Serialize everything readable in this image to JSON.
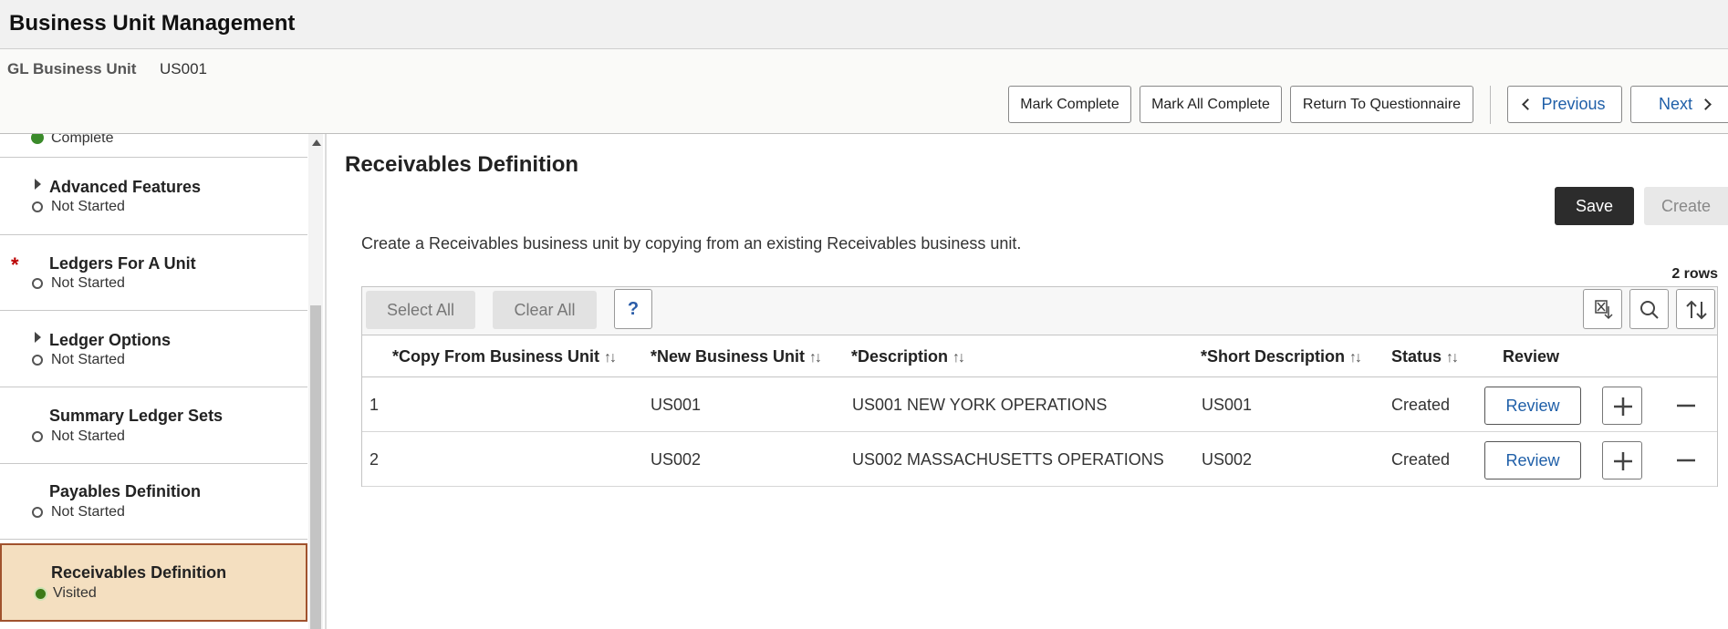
{
  "app": {
    "title": "Business Unit Management"
  },
  "context": {
    "label": "GL Business Unit",
    "value": "US001"
  },
  "header_buttons": {
    "mark_complete": "Mark Complete",
    "mark_all_complete": "Mark All Complete",
    "return_to_questionnaire": "Return To Questionnaire",
    "previous": "Previous",
    "next": "Next"
  },
  "sidebar": {
    "items": [
      {
        "title": "",
        "status": "Complete"
      },
      {
        "title": "Advanced Features",
        "status": "Not Started"
      },
      {
        "title": "Ledgers For A Unit",
        "status": "Not Started",
        "required_mark": "*"
      },
      {
        "title": "Ledger Options",
        "status": "Not Started"
      },
      {
        "title": "Summary Ledger Sets",
        "status": "Not Started"
      },
      {
        "title": "Payables Definition",
        "status": "Not Started"
      },
      {
        "title": "Receivables Definition",
        "status": "Visited"
      }
    ]
  },
  "main": {
    "title": "Receivables Definition",
    "save_label": "Save",
    "create_label": "Create",
    "intro": "Create a Receivables business unit by copying from an existing Receivables business unit.",
    "row_count": "2 rows"
  },
  "grid": {
    "select_all": "Select All",
    "clear_all": "Clear All",
    "help": "?",
    "columns": [
      "*Copy From Business Unit",
      "*New Business Unit",
      "*Description",
      "*Short Description",
      "Status",
      "Review"
    ],
    "sort_glyph": "↑↓",
    "rows": [
      {
        "num": "1",
        "copy_from": "",
        "new_bu": "US001",
        "description": "US001 NEW YORK OPERATIONS",
        "short_desc": "US001",
        "status": "Created",
        "review": "Review"
      },
      {
        "num": "2",
        "copy_from": "",
        "new_bu": "US002",
        "description": "US002 MASSACHUSETTS OPERATIONS",
        "short_desc": "US002",
        "status": "Created",
        "review": "Review"
      }
    ]
  },
  "colors": {
    "accent_link": "#1f5fa8",
    "active_bg": "#f4dfc0",
    "active_border": "#a0522d",
    "visited_dot": "#3b7a17"
  }
}
